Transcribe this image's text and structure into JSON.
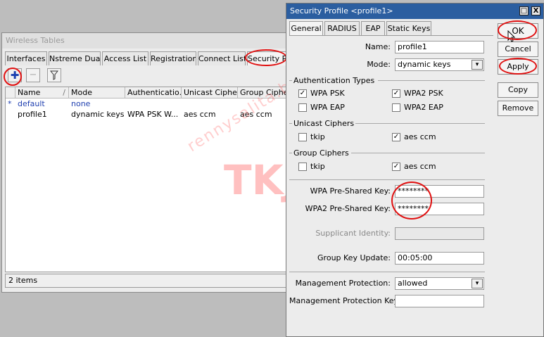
{
  "wireless_tables": {
    "title": "Wireless Tables",
    "tabs": [
      "Interfaces",
      "Nstreme Dual",
      "Access List",
      "Registration",
      "Connect List",
      "Security Pr"
    ],
    "columns": [
      "Name",
      "Mode",
      "Authenticatio...",
      "Unicast Ciphers",
      "Group Ciphers"
    ],
    "rows": [
      {
        "marker": "*",
        "name": "default",
        "mode": "none",
        "auth": "",
        "unicast": "",
        "group": ""
      },
      {
        "marker": "",
        "name": "profile1",
        "mode": "dynamic keys",
        "auth": "WPA PSK W...",
        "unicast": "aes ccm",
        "group": "aes ccm"
      }
    ],
    "status": "2 items",
    "sort_glyph": "/",
    "toolbar_icons": [
      "add-icon",
      "remove-icon",
      "filter-icon"
    ]
  },
  "security_profile": {
    "title": "Security Profile <profile1>",
    "tabs": [
      "General",
      "RADIUS",
      "EAP",
      "Static Keys"
    ],
    "name_label": "Name:",
    "name_value": "profile1",
    "mode_label": "Mode:",
    "mode_value": "dynamic keys",
    "auth_group": "Authentication Types",
    "auth_types": [
      {
        "label": "WPA PSK",
        "checked": true
      },
      {
        "label": "WPA2 PSK",
        "checked": true
      },
      {
        "label": "WPA EAP",
        "checked": false
      },
      {
        "label": "WPA2 EAP",
        "checked": false
      }
    ],
    "unicast_group": "Unicast Ciphers",
    "unicast": [
      {
        "label": "tkip",
        "checked": false
      },
      {
        "label": "aes ccm",
        "checked": true
      }
    ],
    "group_group": "Group Ciphers",
    "group": [
      {
        "label": "tkip",
        "checked": false
      },
      {
        "label": "aes ccm",
        "checked": true
      }
    ],
    "wpa_psk_label": "WPA Pre-Shared Key:",
    "wpa_psk_value": "********",
    "wpa2_psk_label": "WPA2 Pre-Shared Key:",
    "wpa2_psk_value": "********",
    "supplicant_label": "Supplicant Identity:",
    "supplicant_value": "",
    "group_key_label": "Group Key Update:",
    "group_key_value": "00:05:00",
    "mgmt_label": "Management Protection:",
    "mgmt_value": "allowed",
    "mgmt_key_label": "Management Protection Key:",
    "mgmt_key_value": "",
    "buttons": {
      "ok": "OK",
      "cancel": "Cancel",
      "apply": "Apply",
      "copy": "Copy",
      "remove": "Remove"
    },
    "winbtns": [
      "□",
      "X"
    ]
  },
  "watermark": {
    "text": "rennysalita.blogspot.com",
    "logo": "TKJ"
  },
  "colors": {
    "title_active": "#2b5ea0",
    "annotation": "#e01010"
  }
}
